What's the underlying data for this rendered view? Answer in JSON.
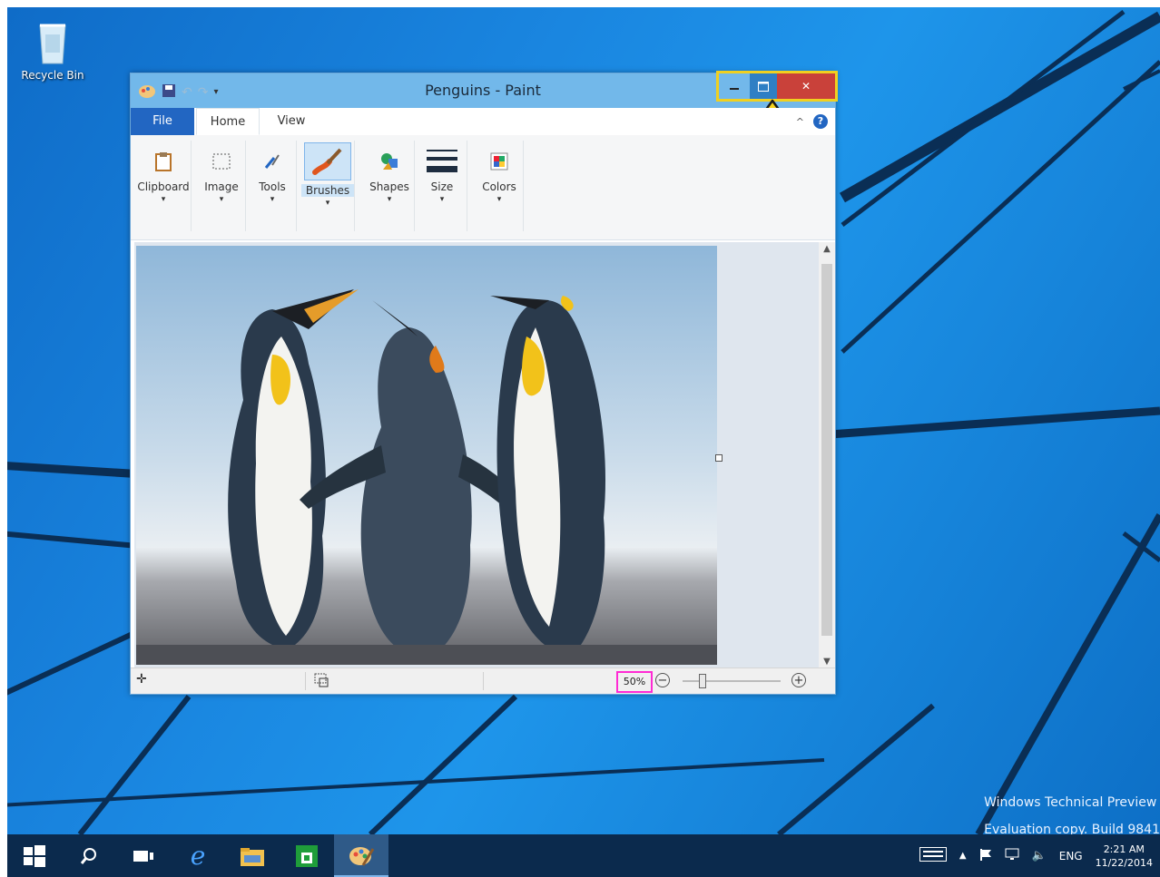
{
  "desktop": {
    "recycle_bin_label": "Recycle Bin",
    "watermark_line1": "Windows Technical Preview",
    "watermark_line2": "Evaluation copy. Build 9841"
  },
  "window": {
    "title": "Penguins - Paint",
    "tabs": {
      "file": "File",
      "home": "Home",
      "view": "View"
    },
    "ribbon_groups": [
      {
        "label": "Clipboard",
        "icon": "clipboard-icon"
      },
      {
        "label": "Image",
        "icon": "select-icon"
      },
      {
        "label": "Tools",
        "icon": "tools-icon"
      },
      {
        "label": "Brushes",
        "icon": "brush-icon"
      },
      {
        "label": "Shapes",
        "icon": "shapes-icon"
      },
      {
        "label": "Size",
        "icon": "size-icon"
      },
      {
        "label": "Colors",
        "icon": "colors-icon"
      }
    ],
    "status": {
      "zoom": "50%"
    }
  },
  "taskbar": {
    "language": "ENG",
    "time": "2:21 AM",
    "date": "11/22/2014"
  },
  "colors": {
    "titlebar": "#72b8ea",
    "file_tab": "#2266c2",
    "close_button": "#c9413a",
    "highlight_yellow": "#f0d020",
    "highlight_magenta": "#ff2ad4",
    "taskbar": "#0b2a4d"
  }
}
